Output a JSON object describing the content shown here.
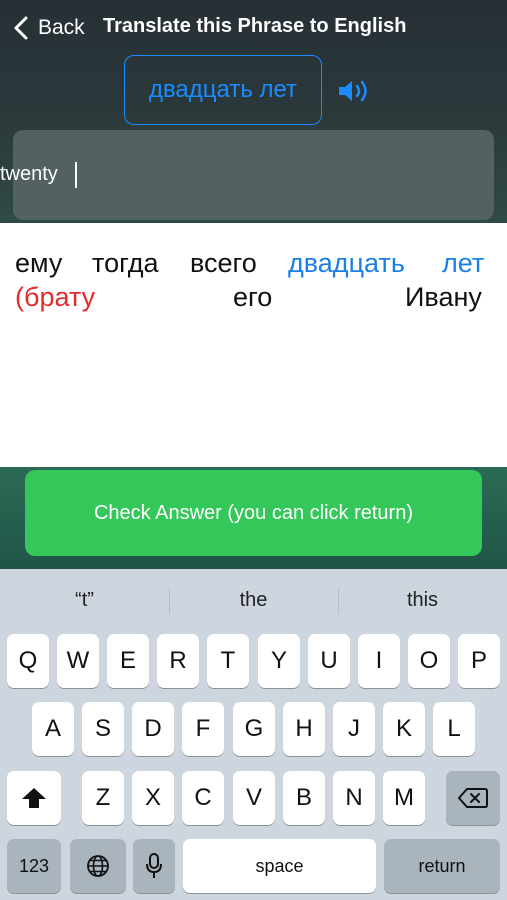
{
  "nav": {
    "back_label": "Back",
    "title": "Translate this Phrase to English"
  },
  "phrase": {
    "text": "двадцать лет",
    "speaker_icon": "speaker-icon"
  },
  "answer": {
    "value": "twenty"
  },
  "sentence": {
    "words": [
      {
        "text": "ему",
        "style": "normal"
      },
      {
        "text": "тогда",
        "style": "normal"
      },
      {
        "text": "всего",
        "style": "normal"
      },
      {
        "text": "двадцать",
        "style": "highlight"
      },
      {
        "text": "лет",
        "style": "highlight"
      },
      {
        "text": "(брату",
        "style": "error"
      },
      {
        "text": "его",
        "style": "normal"
      },
      {
        "text": "Ивану",
        "style": "normal"
      }
    ]
  },
  "check_button": {
    "label": "Check Answer (you can click return)"
  },
  "keyboard": {
    "suggestions": [
      "“t”",
      "the",
      "this"
    ],
    "row1": [
      "Q",
      "W",
      "E",
      "R",
      "T",
      "Y",
      "U",
      "I",
      "O",
      "P"
    ],
    "row2": [
      "A",
      "S",
      "D",
      "F",
      "G",
      "H",
      "J",
      "K",
      "L"
    ],
    "row3": [
      "Z",
      "X",
      "C",
      "V",
      "B",
      "N",
      "M"
    ],
    "numbers_label": "123",
    "space_label": "space",
    "return_label": "return"
  },
  "colors": {
    "accent_blue": "#1a8cff",
    "error_red": "#e32b2b",
    "cta_green": "#34c759"
  }
}
